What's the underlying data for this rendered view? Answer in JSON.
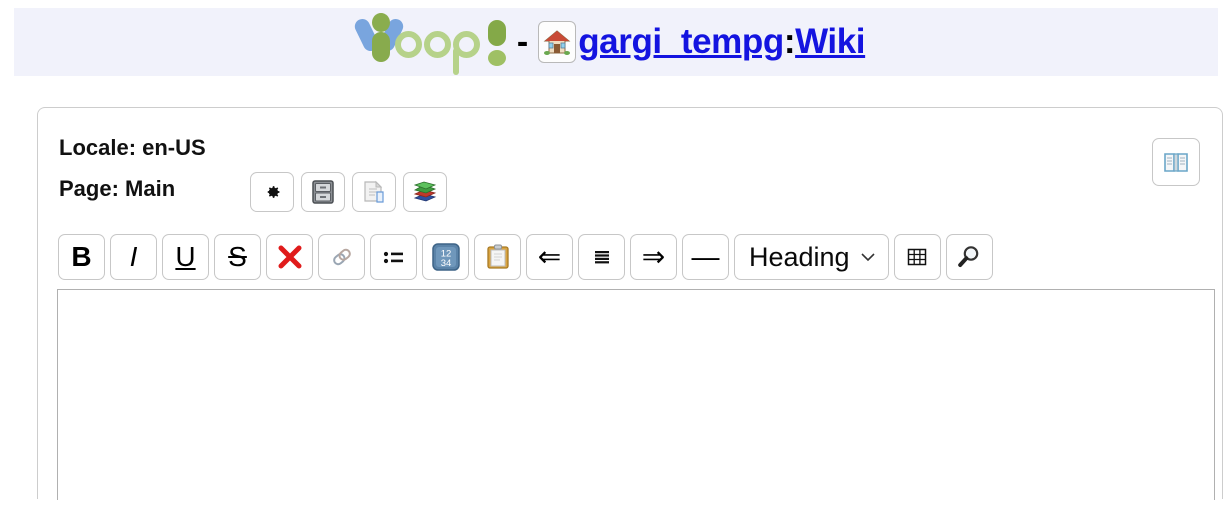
{
  "header": {
    "logo_name": "Yoop",
    "separator": "-",
    "home_icon": "home-icon",
    "title_space": "gargi_tempg",
    "title_separator": ":",
    "title_page": "Wiki",
    "link_color": "#1414e0",
    "band_bg": "#f1f2fb"
  },
  "panel": {
    "locale_label": "Locale: en-US",
    "page_label": "Page: Main",
    "page_actions": [
      {
        "name": "settings-button",
        "icon": "gear-icon",
        "title": "Settings"
      },
      {
        "name": "file-cabinet-button",
        "icon": "file-cabinet-icon",
        "title": "Archive"
      },
      {
        "name": "copy-page-button",
        "icon": "document-copy-icon",
        "title": "Copy page"
      },
      {
        "name": "books-button",
        "icon": "stacked-books-icon",
        "title": "Library"
      }
    ],
    "help_button": {
      "name": "open-book-button",
      "icon": "open-book-icon",
      "title": "Help"
    }
  },
  "toolbar": {
    "buttons": [
      {
        "name": "bold-button",
        "label": "B",
        "style": "fmt-b"
      },
      {
        "name": "italic-button",
        "label": "I",
        "style": "fmt-i"
      },
      {
        "name": "underline-button",
        "label": "U",
        "style": "fmt-u"
      },
      {
        "name": "strikethrough-button",
        "label": "S",
        "style": "fmt-s"
      }
    ],
    "remove-format": {
      "name": "remove-format-button",
      "icon": "red-x-icon",
      "color": "#e01b1b"
    },
    "link": {
      "name": "insert-link-button",
      "icon": "chain-link-icon"
    },
    "bullet_list": {
      "name": "bullet-list-button",
      "icon": "bulleted-list-icon"
    },
    "numbered_list": {
      "name": "numbered-list-button",
      "icon": "numbered-list-icon",
      "digits_top": "12",
      "digits_bottom": "34"
    },
    "paste": {
      "name": "paste-button",
      "icon": "clipboard-icon"
    },
    "outdent": {
      "name": "outdent-button",
      "icon": "arrow-left-icon",
      "glyph": "⇐"
    },
    "align": {
      "name": "align-button",
      "icon": "align-lines-icon"
    },
    "indent": {
      "name": "indent-button",
      "icon": "arrow-right-icon",
      "glyph": "⇒"
    },
    "hr": {
      "name": "horizontal-rule-button",
      "icon": "horizontal-rule-icon",
      "glyph": "—"
    },
    "heading_select": {
      "name": "heading-select",
      "value": "Heading",
      "chevron": "⌄"
    },
    "table": {
      "name": "insert-table-button",
      "icon": "table-grid-icon"
    },
    "search": {
      "name": "search-button",
      "icon": "magnifier-icon"
    }
  },
  "editor": {
    "name": "wiki-content-textarea",
    "value": "",
    "placeholder": ""
  }
}
